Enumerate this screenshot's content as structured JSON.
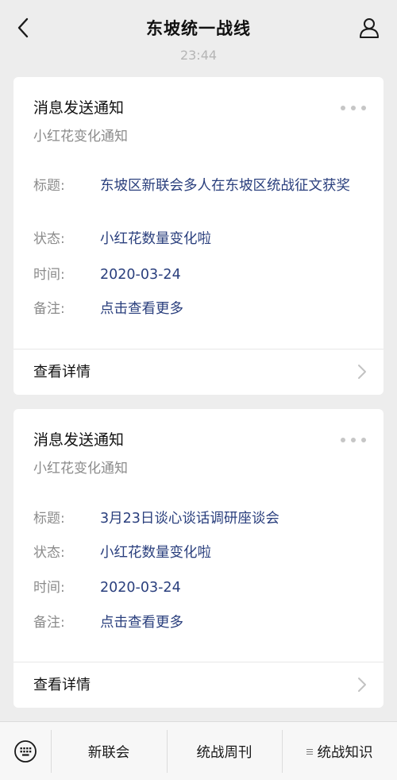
{
  "header": {
    "title": "东坡统一战线",
    "back_icon": "chevron-left-icon",
    "profile_icon": "person-icon"
  },
  "timestamp": "23:44",
  "messages": [
    {
      "title": "消息发送通知",
      "subtitle": "小红花变化通知",
      "fields": [
        {
          "label": "标题:",
          "value": "东坡区新联会多人在东坡区统战征文获奖"
        },
        {
          "label": "状态:",
          "value": "小红花数量变化啦"
        },
        {
          "label": "时间:",
          "value": "2020-03-24"
        },
        {
          "label": "备注:",
          "value": "点击查看更多"
        }
      ],
      "detail_label": "查看详情"
    },
    {
      "title": "消息发送通知",
      "subtitle": "小红花变化通知",
      "fields": [
        {
          "label": "标题:",
          "value": "3月23日谈心谈话调研座谈会"
        },
        {
          "label": "状态:",
          "value": "小红花数量变化啦"
        },
        {
          "label": "时间:",
          "value": "2020-03-24"
        },
        {
          "label": "备注:",
          "value": "点击查看更多"
        }
      ],
      "detail_label": "查看详情"
    }
  ],
  "bottom_menu": {
    "keyboard_icon": "keyboard-icon",
    "items": [
      {
        "label": "新联会"
      },
      {
        "label": "统战周刊"
      },
      {
        "label": "统战知识",
        "icon": "submenu-lines-icon"
      }
    ]
  },
  "colors": {
    "background": "#ededed",
    "card": "#ffffff",
    "value_text": "#2a3f7d",
    "label_text": "#8b8b8b"
  }
}
